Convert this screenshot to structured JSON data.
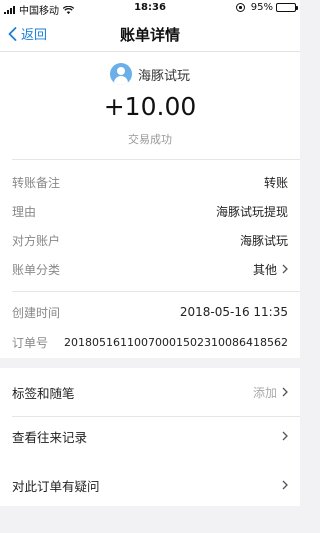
{
  "status_bar": {
    "carrier": "中国移动",
    "time": "18:36",
    "battery_text": "95%",
    "battery_level": 0.95
  },
  "nav": {
    "back_label": "返回",
    "title": "账单详情"
  },
  "summary": {
    "payee_name": "海豚试玩",
    "amount": "+10.00",
    "status": "交易成功"
  },
  "details": {
    "rows": [
      {
        "label": "转账备注",
        "value": "转账"
      },
      {
        "label": "理由",
        "value": "海豚试玩提现"
      },
      {
        "label": "对方账户",
        "value": "海豚试玩"
      },
      {
        "label": "账单分类",
        "value": "其他"
      }
    ],
    "created_label": "创建时间",
    "created_value": "2018-05-16 11:35",
    "order_label": "订单号",
    "order_value": "20180516110070001502310086418562"
  },
  "actions": {
    "tags_label": "标签和随笔",
    "tags_action": "添加",
    "history_label": "查看往来记录",
    "question_label": "对此订单有疑问"
  }
}
